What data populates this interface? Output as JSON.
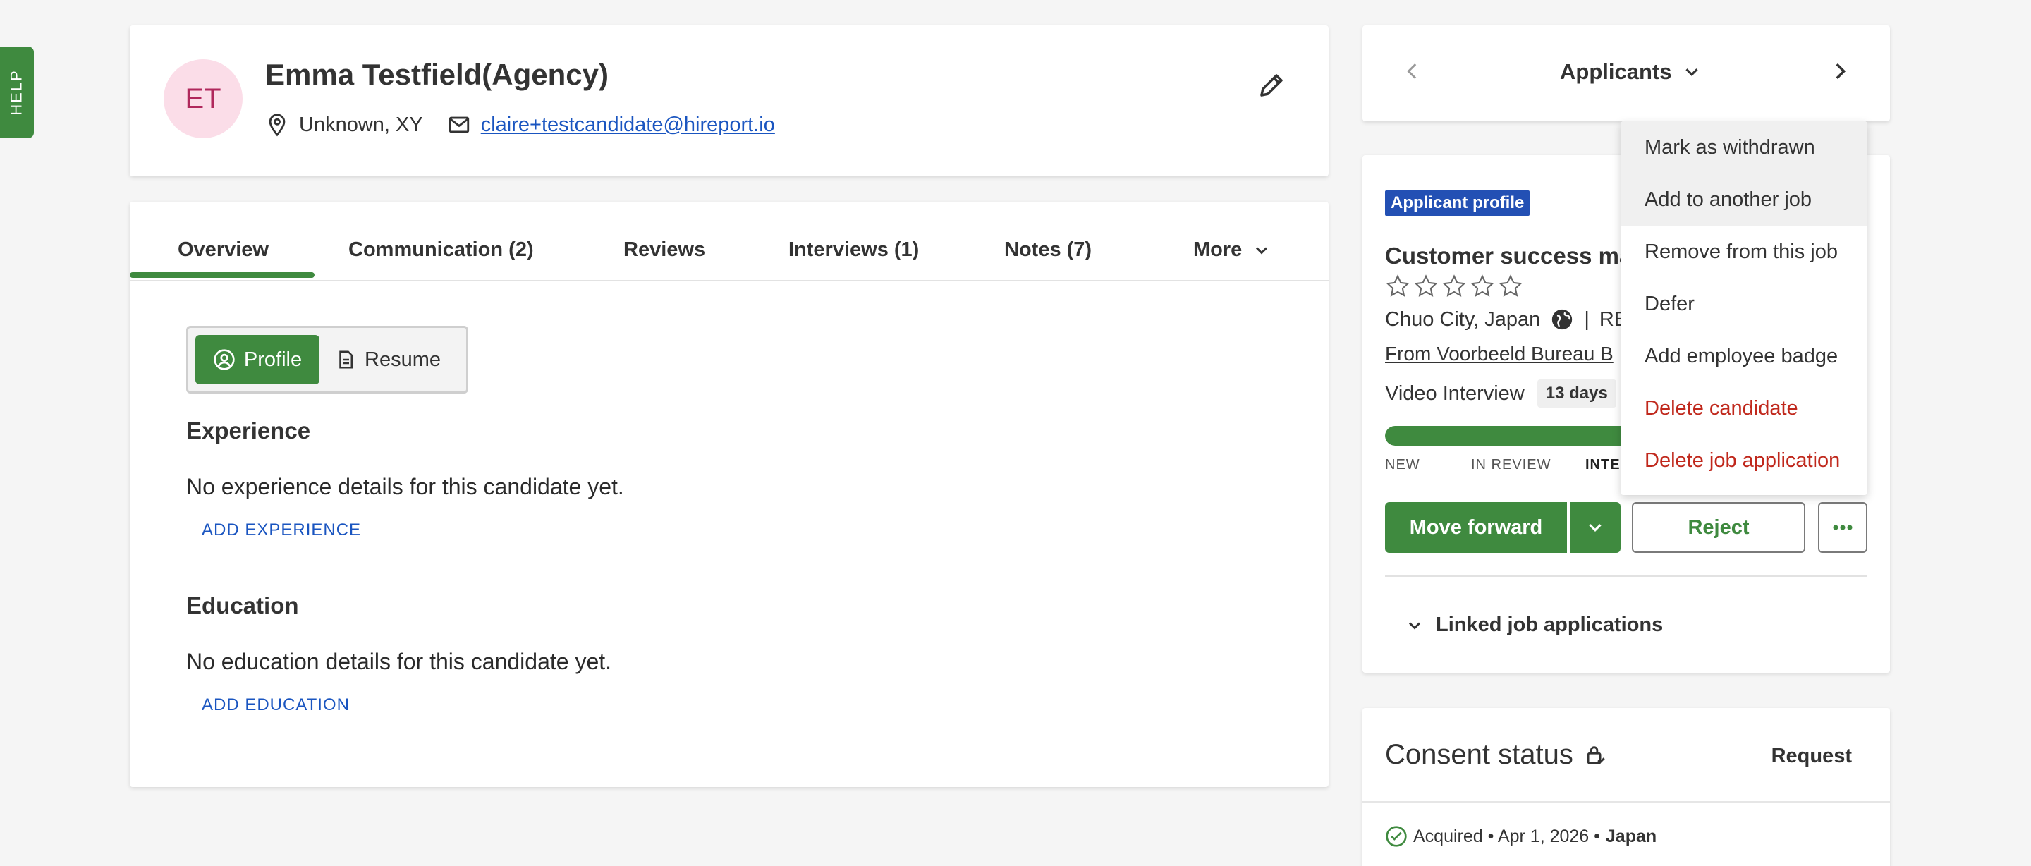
{
  "help": {
    "label": "HELP"
  },
  "candidate": {
    "initials": "ET",
    "name": "Emma Testfield(Agency)",
    "location": "Unknown, XY",
    "email": "claire+testcandidate@hireport.io"
  },
  "tabs": [
    {
      "label": "Overview"
    },
    {
      "label": "Communication  (2)"
    },
    {
      "label": "Reviews"
    },
    {
      "label": "Interviews  (1)"
    },
    {
      "label": "Notes  (7)"
    },
    {
      "label": "More"
    }
  ],
  "segmented": {
    "profile": "Profile",
    "resume": "Resume"
  },
  "experience": {
    "title": "Experience",
    "empty": "No experience details for this candidate yet.",
    "add": "ADD EXPERIENCE"
  },
  "education": {
    "title": "Education",
    "empty": "No education details for this candidate yet.",
    "add": "ADD EDUCATION"
  },
  "nav": {
    "title": "Applicants"
  },
  "application": {
    "badge": "Applicant profile",
    "job_title": "Customer success ma",
    "rating": 0,
    "rating_max": 5,
    "location": "Chuo City, Japan",
    "sep": "|",
    "remote": "RE",
    "source": "From Voorbeeld Bureau B",
    "stage": "Video Interview",
    "stage_days": "13 days",
    "progress": 0.57,
    "stages": [
      "NEW",
      "IN REVIEW",
      "INTEI"
    ],
    "move_forward": "Move forward",
    "reject": "Reject",
    "linked": "Linked job applications"
  },
  "consent": {
    "title": "Consent status",
    "request": "Request",
    "status": "Acquired • Apr 1, 2026 •",
    "region": "Japan"
  },
  "menu": [
    {
      "label": "Mark as withdrawn",
      "highlight": true,
      "danger": false
    },
    {
      "label": "Add to another job",
      "highlight": true,
      "danger": false
    },
    {
      "label": "Remove from this job",
      "highlight": false,
      "danger": false
    },
    {
      "label": "Defer",
      "highlight": false,
      "danger": false
    },
    {
      "label": "Add employee badge",
      "highlight": false,
      "danger": false
    },
    {
      "label": "Delete candidate",
      "highlight": false,
      "danger": true
    },
    {
      "label": "Delete job application",
      "highlight": false,
      "danger": true
    }
  ],
  "colors": {
    "primary": "#3f8a3f",
    "link": "#1a55c0",
    "badge": "#2350b4",
    "danger": "#c0281c",
    "avatar_bg": "#fbdde8",
    "avatar_fg": "#b0285c"
  }
}
